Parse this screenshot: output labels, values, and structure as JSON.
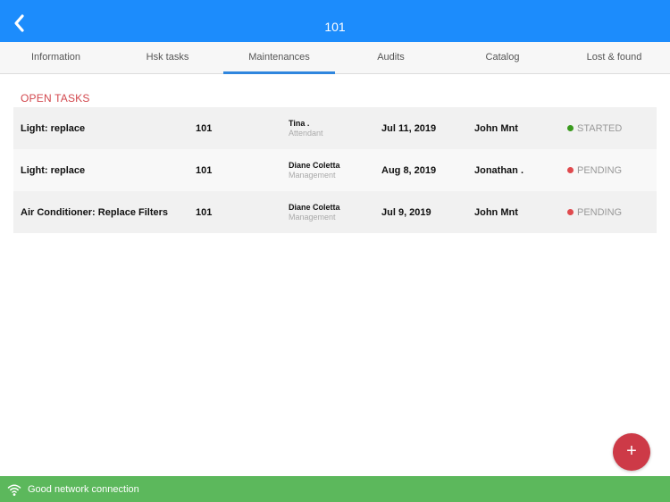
{
  "header": {
    "title": "101",
    "back_icon": "chevron-left-icon",
    "background": "#1c8cfc"
  },
  "tabs": [
    {
      "label": "Information",
      "active": false
    },
    {
      "label": "Hsk tasks",
      "active": false
    },
    {
      "label": "Maintenances",
      "active": true
    },
    {
      "label": "Audits",
      "active": false
    },
    {
      "label": "Catalog",
      "active": false
    },
    {
      "label": "Lost & found",
      "active": false
    }
  ],
  "section": {
    "title": "OPEN TASKS",
    "color": "#d2474d"
  },
  "tasks": [
    {
      "task": "Light: replace",
      "room": "101",
      "reporter_name": "Tina .",
      "reporter_role": "Attendant",
      "date": "Jul 11, 2019",
      "assignee": "John Mnt",
      "status": "STARTED",
      "status_color": "#3a9a1e"
    },
    {
      "task": "Light: replace",
      "room": "101",
      "reporter_name": "Diane Coletta",
      "reporter_role": "Management",
      "date": "Aug 8, 2019",
      "assignee": "Jonathan .",
      "status": "PENDING",
      "status_color": "#e04a4e"
    },
    {
      "task": "Air Conditioner: Replace Filters",
      "room": "101",
      "reporter_name": "Diane Coletta",
      "reporter_role": "Management",
      "date": "Jul 9, 2019",
      "assignee": "John Mnt",
      "status": "PENDING",
      "status_color": "#e04a4e"
    }
  ],
  "fab": {
    "label": "+",
    "icon": "plus-icon",
    "color": "#cd3a47"
  },
  "network": {
    "icon": "wifi-icon",
    "text": "Good network connection",
    "color": "#5cb85c"
  }
}
